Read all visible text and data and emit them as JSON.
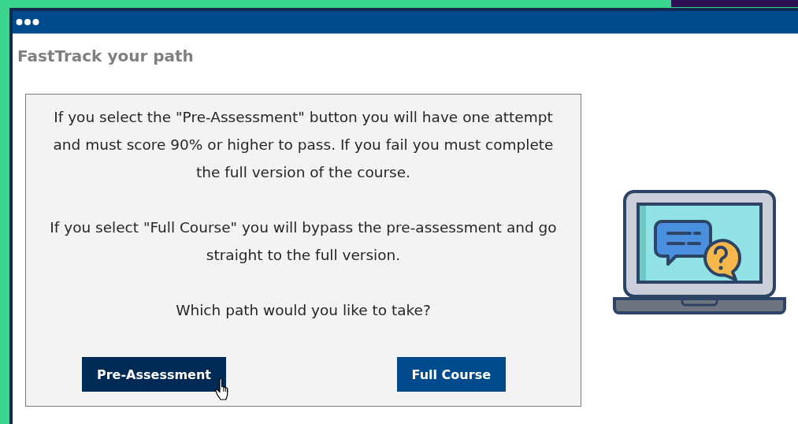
{
  "window": {
    "title": "FastTrack your path"
  },
  "message": {
    "paragraphs": [
      "If you select the \"Pre-Assessment\" button you will have one attempt and must score 90% or higher to pass. If you fail you must complete the full version of the course.",
      "If you select \"Full Course\" you will bypass the pre-assessment and go straight to the full version."
    ],
    "question": "Which path would you like to take?"
  },
  "buttons": [
    {
      "label": "Pre-Assessment",
      "hovered": true
    },
    {
      "label": "Full Course",
      "hovered": false
    }
  ]
}
